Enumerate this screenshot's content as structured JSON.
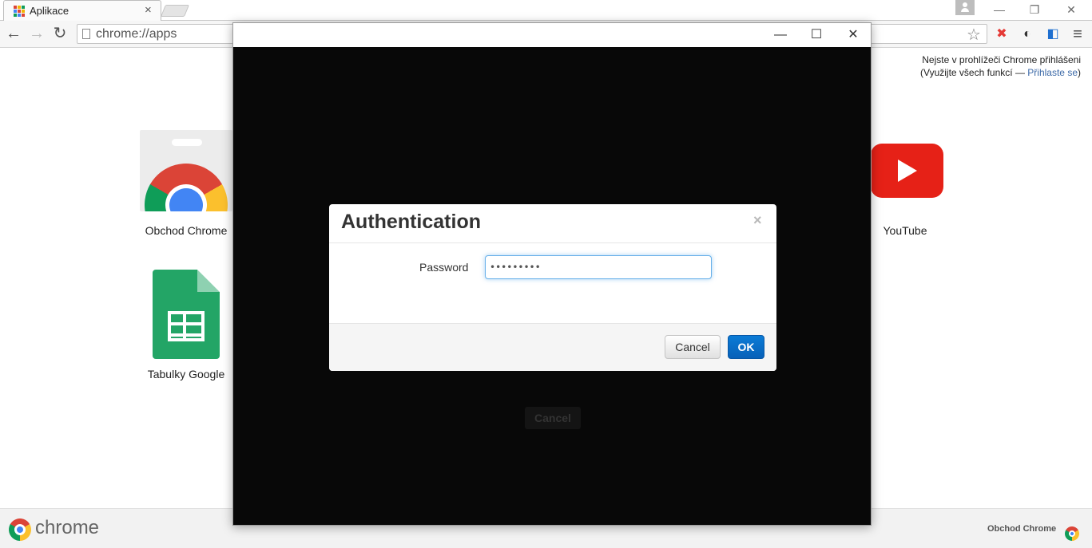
{
  "browser": {
    "tab_title": "Aplikace",
    "tab_close": "×",
    "url": "chrome://apps",
    "window_controls": {
      "minimize": "—",
      "restore": "❐",
      "close": "✕"
    }
  },
  "toolbar": {
    "back": "←",
    "forward": "→",
    "reload": "↻",
    "star": "☆",
    "menu": "≡"
  },
  "signin": {
    "line1": "Nejste v prohlížeči Chrome přihlášeni",
    "line2_prefix": "(Využijte všech funkcí — ",
    "line2_link": "Přihlaste se",
    "line2_suffix": ")"
  },
  "apps": [
    {
      "label": "Obchod Chrome"
    },
    {
      "label": "Tabulky Google"
    },
    {
      "label": "YouTube"
    }
  ],
  "bottombar": {
    "brand": "chrome",
    "store_link": "Obchod Chrome"
  },
  "popup": {
    "controls": {
      "minimize": "—",
      "maximize": "☐",
      "close": "✕"
    },
    "behind_cancel": "Cancel"
  },
  "modal": {
    "title": "Authentication",
    "close": "×",
    "password_label": "Password",
    "password_value": "•••••••••",
    "cancel_label": "Cancel",
    "ok_label": "OK"
  },
  "colors": {
    "accent_blue": "#0a7bd6",
    "youtube_red": "#e62117",
    "sheets_green": "#23a566"
  }
}
